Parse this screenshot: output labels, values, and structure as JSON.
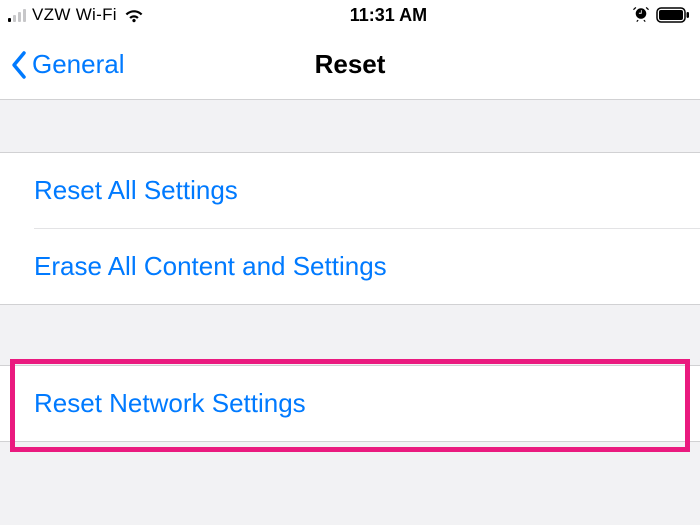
{
  "status": {
    "carrier": "VZW Wi-Fi",
    "time": "11:31 AM"
  },
  "nav": {
    "back_label": "General",
    "title": "Reset"
  },
  "section1": {
    "row0": "Reset All Settings",
    "row1": "Erase All Content and Settings"
  },
  "section2": {
    "row0": "Reset Network Settings"
  }
}
